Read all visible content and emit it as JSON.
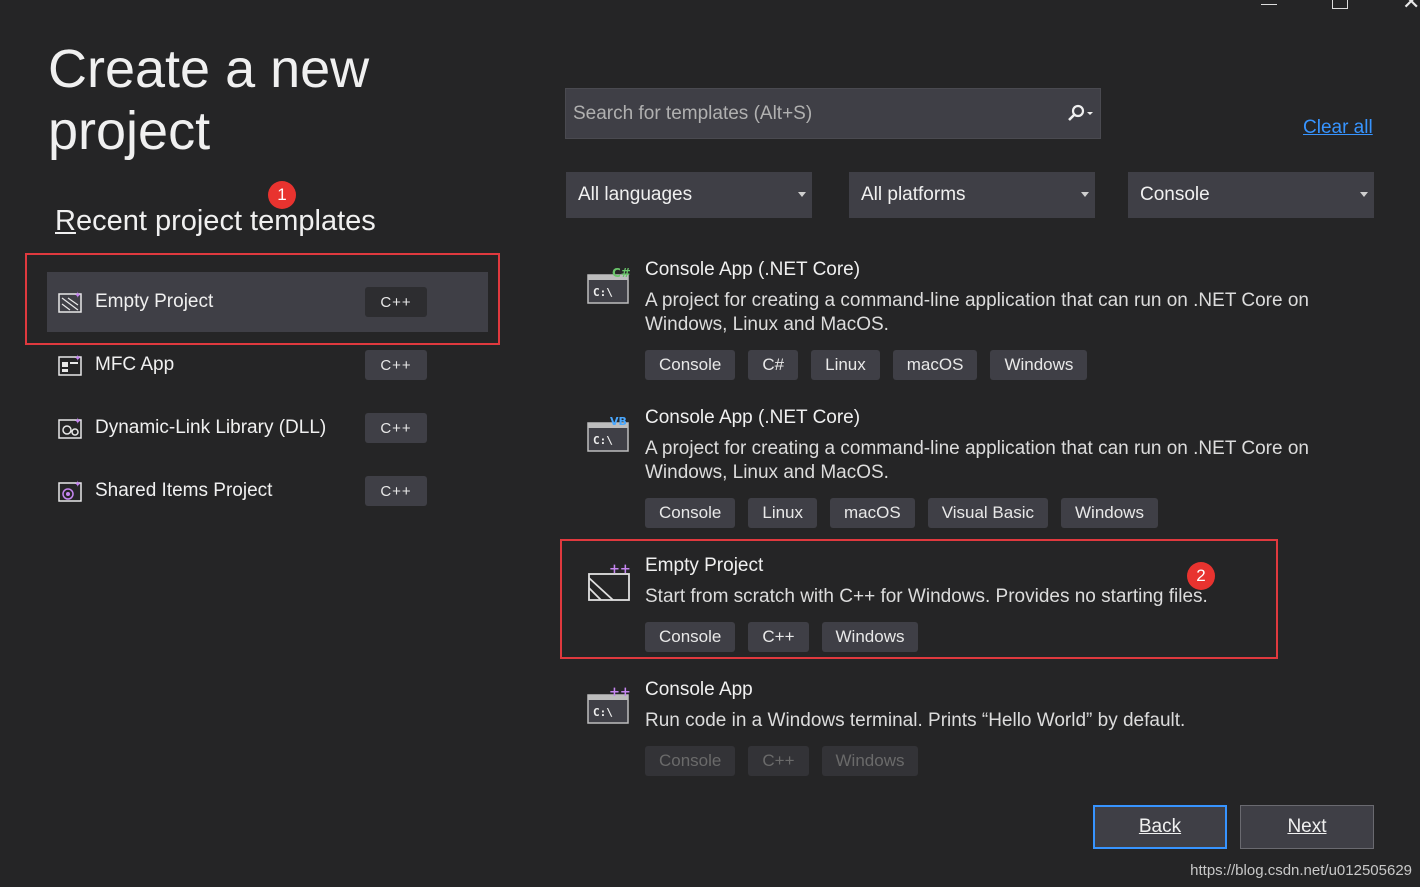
{
  "title": "Create a new project",
  "recent": {
    "heading": "Recent project templates",
    "items": [
      {
        "label": "Empty Project",
        "lang": "C++",
        "icon": "empty-project-icon"
      },
      {
        "label": "MFC App",
        "lang": "C++",
        "icon": "mfc-app-icon"
      },
      {
        "label": "Dynamic-Link Library (DLL)",
        "lang": "C++",
        "icon": "dll-icon"
      },
      {
        "label": "Shared Items Project",
        "lang": "C++",
        "icon": "shared-items-icon"
      }
    ]
  },
  "annotations": {
    "one": "1",
    "two": "2"
  },
  "search": {
    "placeholder": "Search for templates (Alt+S)"
  },
  "clear_all": "Clear all",
  "filters": {
    "language": "All languages",
    "platform": "All platforms",
    "project_type": "Console"
  },
  "templates": [
    {
      "name": "Console App (.NET Core)",
      "badge": "C#",
      "desc": "A project for creating a command-line application that can run on .NET Core on Windows, Linux and MacOS.",
      "tags": [
        "Console",
        "C#",
        "Linux",
        "macOS",
        "Windows"
      ]
    },
    {
      "name": "Console App (.NET Core)",
      "badge": "VB",
      "desc": "A project for creating a command-line application that can run on .NET Core on Windows, Linux and MacOS.",
      "tags": [
        "Console",
        "Linux",
        "macOS",
        "Visual Basic",
        "Windows"
      ]
    },
    {
      "name": "Empty Project",
      "badge": "++",
      "desc": "Start from scratch with C++ for Windows. Provides no starting files.",
      "tags": [
        "Console",
        "C++",
        "Windows"
      ]
    },
    {
      "name": "Console App",
      "badge": "++",
      "desc": "Run code in a Windows terminal. Prints “Hello World” by default.",
      "tags": [
        "Console",
        "C++",
        "Windows"
      ]
    }
  ],
  "buttons": {
    "back": "Back",
    "next": "Next"
  },
  "watermark": "https://blog.csdn.net/u012505629",
  "colors": {
    "background": "#252526",
    "panel": "#3f3f46",
    "accent": "#3794ff",
    "annotation": "#e0393e"
  }
}
